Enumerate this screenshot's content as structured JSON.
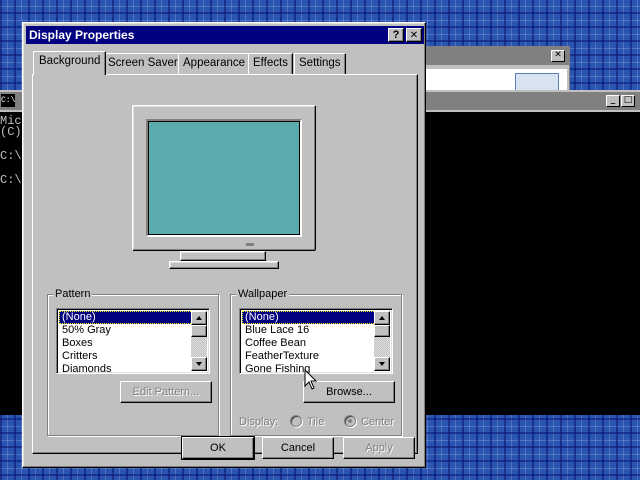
{
  "dialog": {
    "title": "Display Properties",
    "help_glyph": "?",
    "close_glyph": "✕",
    "tabs": [
      {
        "label": "Background",
        "active": true
      },
      {
        "label": "Screen Saver",
        "active": false
      },
      {
        "label": "Appearance",
        "active": false
      },
      {
        "label": "Effects",
        "active": false
      },
      {
        "label": "Settings",
        "active": false
      }
    ],
    "preview": {
      "screen_color": "#5aacac"
    },
    "pattern": {
      "label": "Pattern",
      "items": [
        "(None)",
        "50% Gray",
        "Boxes",
        "Critters",
        "Diamonds"
      ],
      "selected": "(None)",
      "edit_button": "Edit Pattern..."
    },
    "wallpaper": {
      "label": "Wallpaper",
      "items": [
        "(None)",
        "Blue Lace 16",
        "Coffee Bean",
        "FeatherTexture",
        "Gone Fishing"
      ],
      "selected": "(None)",
      "browse_button": "Browse...",
      "display_label": "Display:",
      "display_options": [
        {
          "label": "Tile",
          "checked": false
        },
        {
          "label": "Center",
          "checked": true
        }
      ]
    },
    "buttons": {
      "ok": "OK",
      "cancel": "Cancel",
      "apply": "Apply"
    }
  },
  "console": {
    "lines": [
      "Mic",
      "(C)",
      "",
      "C:\\",
      "",
      "C:\\"
    ],
    "caption_glyph": "C:\\"
  },
  "background_windows": {
    "close_glyph": "✕",
    "max_glyph": "□",
    "min_glyph": "_"
  },
  "colors": {
    "title_active": "#000080",
    "title_inactive": "#808080",
    "face": "#c0c0c0",
    "desktop": "#2a54b2"
  }
}
